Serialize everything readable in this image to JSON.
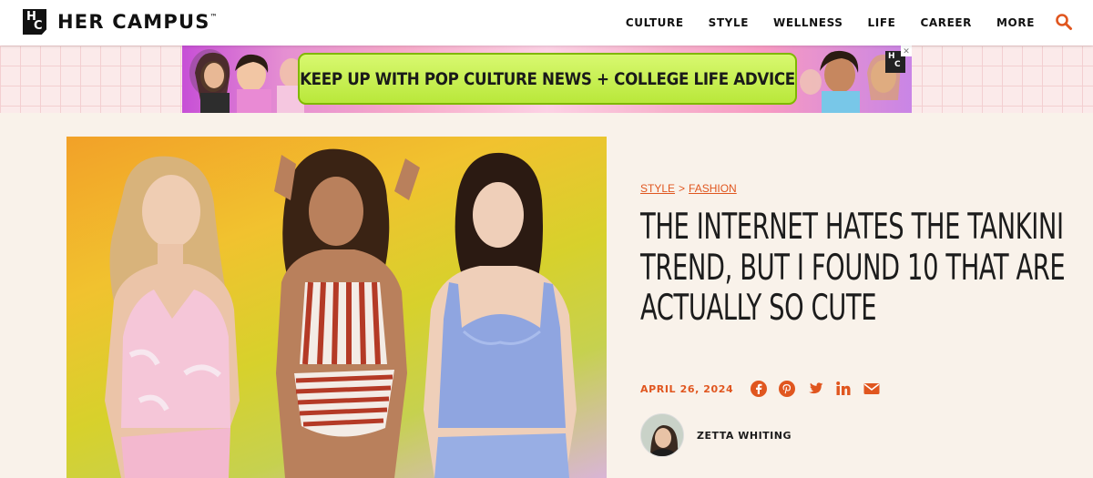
{
  "site": {
    "logo_text": "HER CAMPUS",
    "logo_tm": "™",
    "logo_mark_h": "H",
    "logo_mark_c": "C"
  },
  "nav": {
    "items": [
      {
        "label": "CULTURE"
      },
      {
        "label": "STYLE"
      },
      {
        "label": "WELLNESS"
      },
      {
        "label": "LIFE"
      },
      {
        "label": "CAREER"
      },
      {
        "label": "MORE"
      }
    ],
    "search_icon": "search-icon"
  },
  "ad": {
    "headline": "KEEP UP WITH POP CULTURE NEWS + COLLEGE LIFE ADVICE",
    "close_glyph": "✕"
  },
  "article": {
    "breadcrumb": {
      "category": "STYLE",
      "separator": ">",
      "subcategory": "FASHION"
    },
    "title": "THE INTERNET HATES THE TANKINI TREND, BUT I FOUND 10 THAT ARE ACTUALLY SO CUTE",
    "date": "APRIL 26, 2024",
    "share_icons": [
      "facebook-icon",
      "pinterest-icon",
      "twitter-icon",
      "linkedin-icon",
      "email-icon"
    ],
    "author": "ZETTA WHITING"
  },
  "colors": {
    "accent": "#e0561f",
    "ad_pill": "#c4ee4a",
    "page_bg": "#f9f2ea"
  }
}
